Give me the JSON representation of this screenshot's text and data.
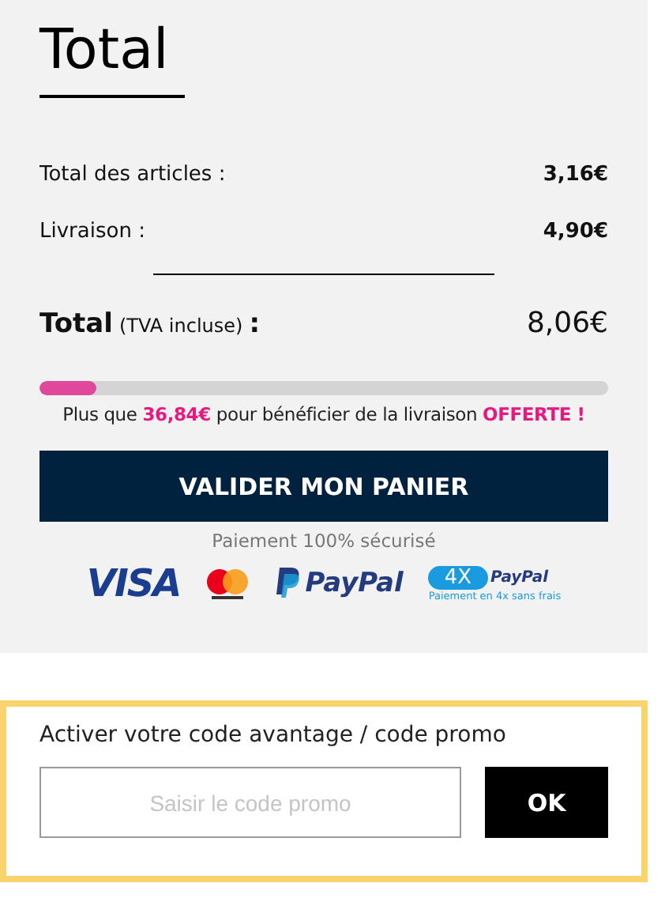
{
  "summary": {
    "title": "Total",
    "lines": [
      {
        "label": "Total des articles :",
        "value": "3,16€"
      },
      {
        "label": "Livraison :",
        "value": "4,90€"
      }
    ],
    "total": {
      "label": "Total",
      "note": "(TVA incluse)",
      "colon": ":",
      "value": "8,06€"
    },
    "shipping_progress": {
      "level": 0.1,
      "message": [
        {
          "text": "Plus que ",
          "highlight": false
        },
        {
          "text": "36,84€",
          "highlight": true
        },
        {
          "text": " pour bénéficier de la livraison ",
          "highlight": false
        },
        {
          "text": "OFFERTE !",
          "highlight": true
        }
      ]
    },
    "checkout_button": "VALIDER MON PANIER",
    "secure_note": "Paiement 100% sécurisé",
    "payment_logos": [
      {
        "kind": "visa",
        "text": "VISA"
      },
      {
        "kind": "mastercard"
      },
      {
        "kind": "paypal",
        "text": "PayPal"
      },
      {
        "kind": "paypal4x",
        "badge": "4X",
        "text": "PayPal",
        "caption": "Paiement en 4x sans frais"
      }
    ]
  },
  "promo": {
    "label": "Activer votre code avantage / code promo",
    "placeholder": "Saisir le code promo",
    "button": "OK"
  }
}
